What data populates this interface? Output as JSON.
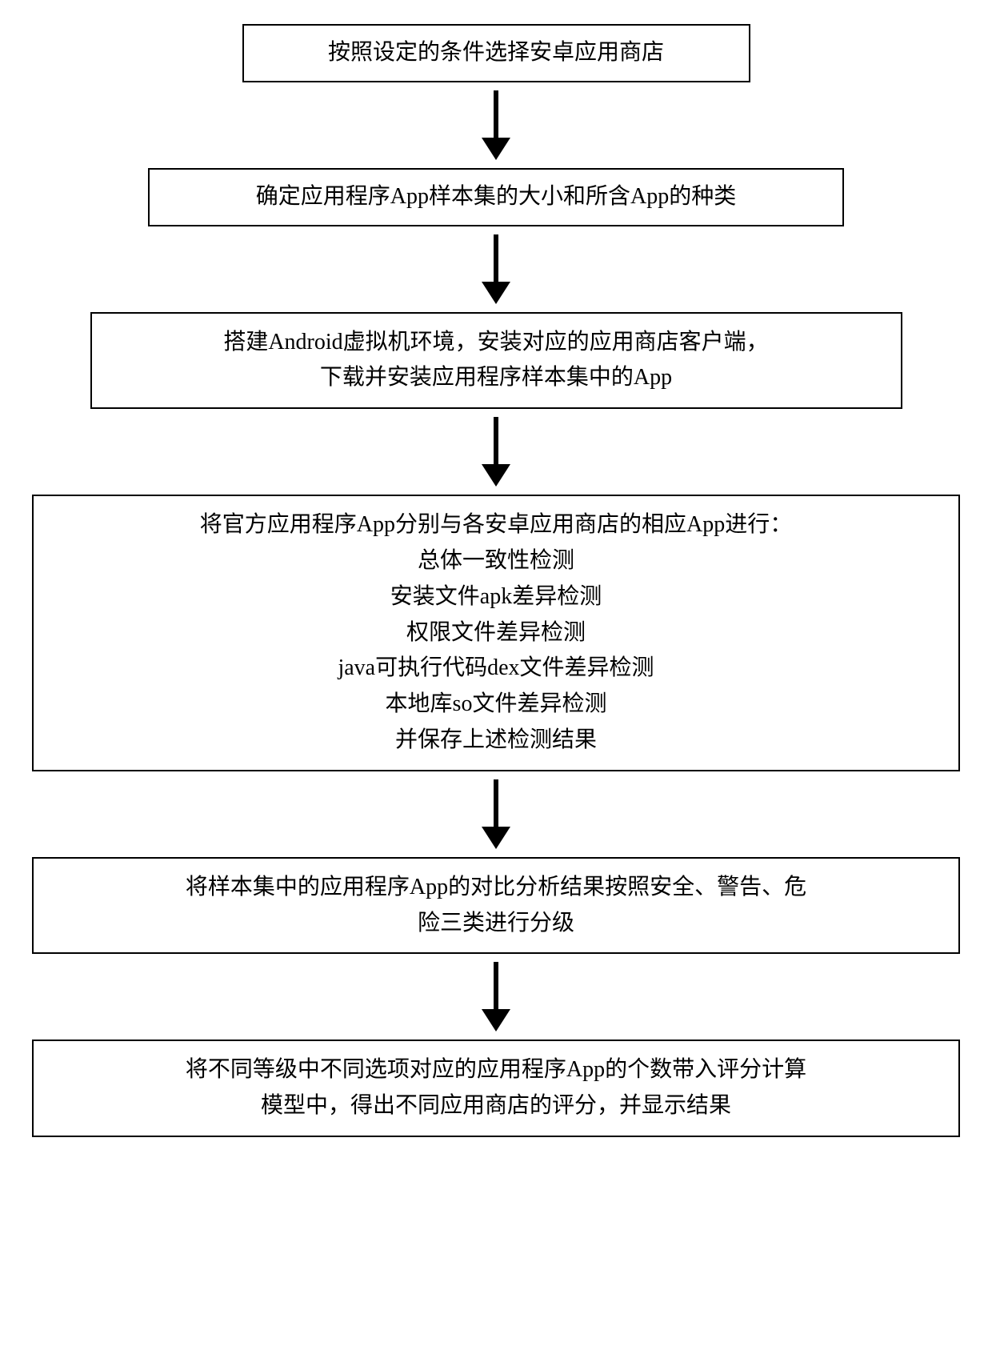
{
  "flowchart": {
    "steps": [
      {
        "lines": [
          "按照设定的条件选择安卓应用商店"
        ]
      },
      {
        "lines": [
          "确定应用程序App样本集的大小和所含App的种类"
        ]
      },
      {
        "lines": [
          "搭建Android虚拟机环境，安装对应的应用商店客户端，",
          "下载并安装应用程序样本集中的App"
        ]
      },
      {
        "lines": [
          "将官方应用程序App分别与各安卓应用商店的相应App进行：",
          "总体一致性检测",
          "安装文件apk差异检测",
          "权限文件差异检测",
          "java可执行代码dex文件差异检测",
          "本地库so文件差异检测",
          "并保存上述检测结果"
        ]
      },
      {
        "lines": [
          "将样本集中的应用程序App的对比分析结果按照安全、警告、危",
          "险三类进行分级"
        ]
      },
      {
        "lines": [
          "将不同等级中不同选项对应的应用程序App的个数带入评分计算",
          "模型中，得出不同应用商店的评分，并显示结果"
        ]
      }
    ]
  }
}
